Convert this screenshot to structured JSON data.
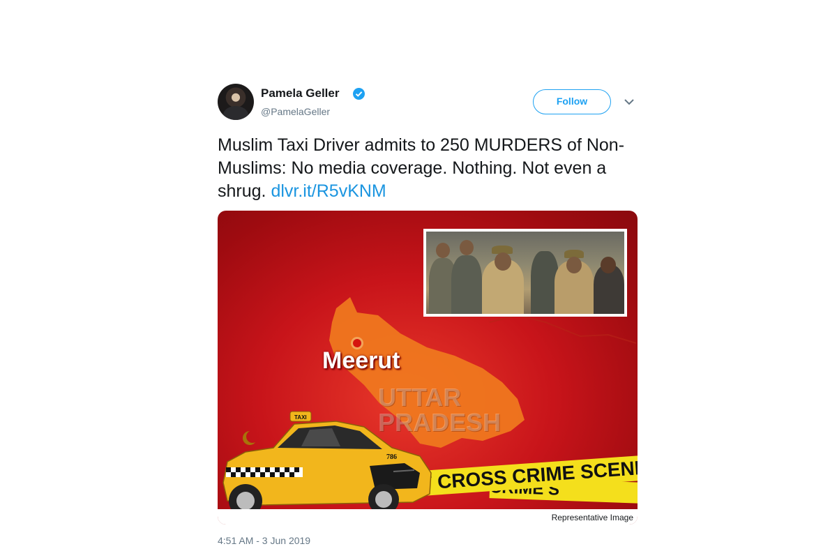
{
  "tweet": {
    "author_name": "Pamela Geller",
    "author_handle": "@PamelaGeller",
    "follow_label": "Follow",
    "text": "Muslim Taxi Driver admits to 250 MURDERS of Non-Muslims: No media coverage. Nothing. Not even a shrug.",
    "link_text": "dlvr.it/R5vKNM",
    "timestamp": "4:51 AM - 3 Jun 2019"
  },
  "media": {
    "place_label": "Meerut",
    "state_line1": "UTTAR",
    "state_line2": "PRADESH",
    "tape_text_1": "T CROSS  CRIME SCENE",
    "tape_text_2": "CRIME S",
    "taxi_sign": "TAXI",
    "taxi_number": "786",
    "caption": "Representative Image"
  },
  "colors": {
    "link": "#1b95e0",
    "follow": "#1da1f2",
    "media_red": "#c8141a",
    "tape_yellow": "#f4df1c",
    "taxi_yellow": "#f2b61c"
  },
  "icons": {
    "verified": "verified-badge-icon",
    "chevron": "chevron-down-icon"
  }
}
